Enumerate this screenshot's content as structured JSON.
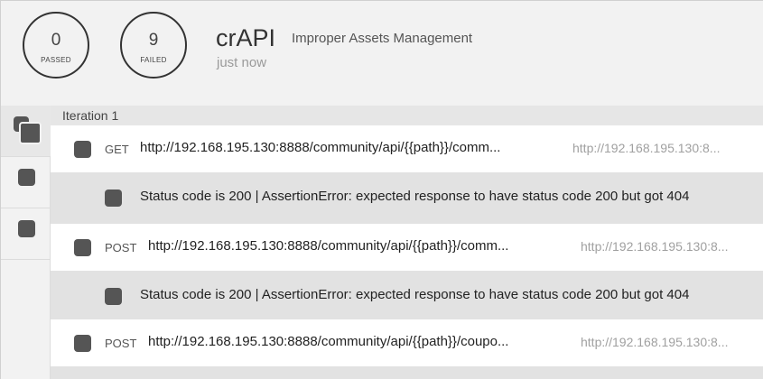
{
  "summary": {
    "passed": {
      "count": "0",
      "label": "PASSED"
    },
    "failed": {
      "count": "9",
      "label": "FAILED"
    },
    "collection": "crAPI",
    "folder": "Improper Assets Management",
    "time": "just now"
  },
  "iteration": {
    "label": "Iteration 1"
  },
  "rows": [
    {
      "kind": "request",
      "method": "GET",
      "url": "http://192.168.195.130:8888/community/api/{{path}}/comm...",
      "resolved": "http://192.168.195.130:8..."
    },
    {
      "kind": "assertion",
      "text": "Status code is 200 | AssertionError: expected response to have status code 200 but got 404"
    },
    {
      "kind": "request",
      "method": "POST",
      "url": "http://192.168.195.130:8888/community/api/{{path}}/comm...",
      "resolved": "http://192.168.195.130:8..."
    },
    {
      "kind": "assertion",
      "text": "Status code is 200 | AssertionError: expected response to have status code 200 but got 404"
    },
    {
      "kind": "request",
      "method": "POST",
      "url": "http://192.168.195.130:8888/community/api/{{path}}/coupo...",
      "resolved": "http://192.168.195.130:8..."
    }
  ],
  "colors": {
    "status_square": "#555555",
    "assertion_bg": "#e2e2e2",
    "request_bg": "#ffffff"
  }
}
